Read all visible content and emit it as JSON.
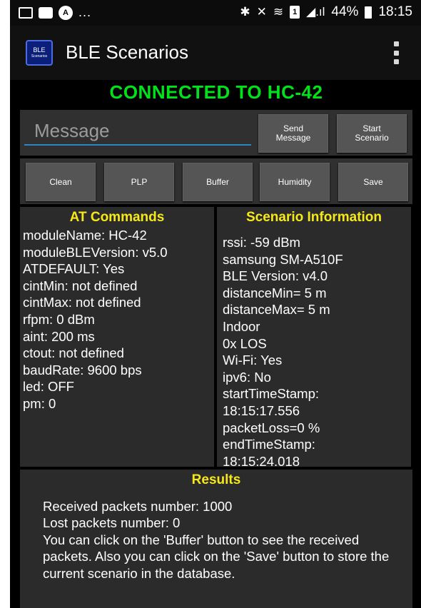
{
  "status_bar": {
    "left_icons": [
      "image-icon",
      "chat-icon",
      "alert-circle-icon"
    ],
    "ellipsis": "...",
    "sim_label": "1",
    "battery_text": "44%",
    "time": "18:15"
  },
  "app_bar": {
    "logo_text": "BLE",
    "logo_subtext": "Scenarios",
    "title": "BLE Scenarios"
  },
  "connection_status": "CONNECTED TO HC-42",
  "message": {
    "placeholder": "Message",
    "value": ""
  },
  "buttons": {
    "send_message": "Send\nMessage",
    "start_scenario": "Start\nScenario",
    "clean": "Clean",
    "plp": "PLP",
    "buffer": "Buffer",
    "humidity": "Humidity",
    "save": "Save"
  },
  "at_commands": {
    "title": "AT Commands",
    "lines": [
      "moduleName: HC-42",
      "moduleBLEVersion: v5.0",
      "ATDEFAULT: Yes",
      "cintMin: not defined",
      "cintMax: not defined",
      "rfpm: 0 dBm",
      "aint: 200 ms",
      "ctout: not defined",
      "baudRate: 9600 bps",
      "led: OFF",
      "pm: 0"
    ]
  },
  "scenario_info": {
    "title": "Scenario Information",
    "lines": [
      "rssi: -59 dBm",
      "samsung SM-A510F",
      "BLE Version: v4.0",
      "distanceMin= 5 m",
      "distanceMax= 5 m",
      "Indoor",
      "0x LOS",
      "Wi-Fi: Yes",
      "ipv6: No",
      "startTimeStamp:",
      "18:15:17.556",
      "packetLoss=0 %",
      "endTimeStamp:",
      "18:15:24.018"
    ]
  },
  "results": {
    "title": "Results",
    "lines": [
      "Received packets number: 1000",
      "Lost packets number: 0",
      "You can click on the 'Buffer' button to see the received packets. Also you can click on the 'Save' button to store the current scenario in the database."
    ]
  },
  "colors": {
    "connected": "#00e21a",
    "section_title": "#f7e81a",
    "input_underline": "#2a87c4",
    "button_bg": "#555555",
    "panel_bg": "#2b2b2b"
  }
}
